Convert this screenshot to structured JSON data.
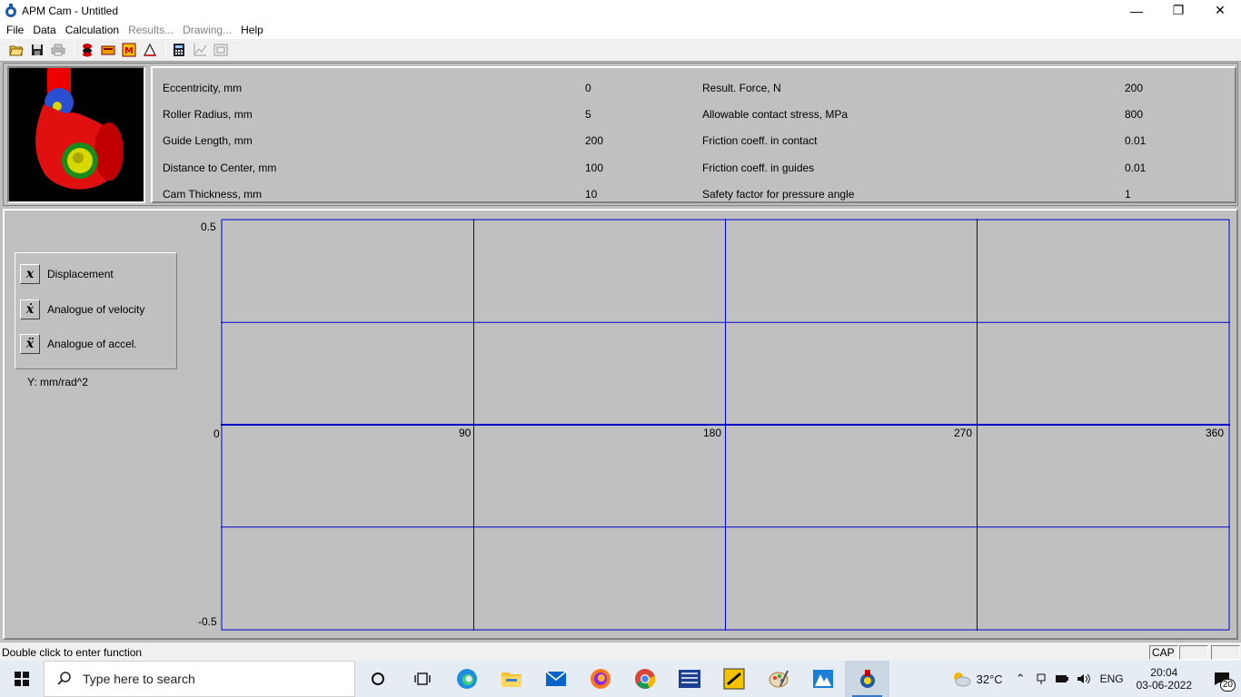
{
  "window": {
    "title": "APM Cam - Untitled",
    "minimize": "—",
    "maximize": "❐",
    "close": "✕"
  },
  "menu": [
    {
      "label": "File",
      "enabled": true
    },
    {
      "label": "Data",
      "enabled": true
    },
    {
      "label": "Calculation",
      "enabled": true
    },
    {
      "label": "Results...",
      "enabled": false
    },
    {
      "label": "Drawing...",
      "enabled": false
    },
    {
      "label": "Help",
      "enabled": true
    }
  ],
  "toolbar": [
    {
      "name": "open-icon"
    },
    {
      "name": "save-icon"
    },
    {
      "name": "print-icon"
    },
    {
      "name": "materials-icon"
    },
    {
      "name": "cam-icon"
    },
    {
      "name": "motion-icon"
    },
    {
      "name": "profile-icon"
    },
    {
      "name": "calculate-icon"
    },
    {
      "name": "chart-icon"
    },
    {
      "name": "drawing-icon"
    }
  ],
  "params_left": [
    {
      "label": "Eccentricity, mm",
      "value": "0"
    },
    {
      "label": "Roller Radius, mm",
      "value": "5"
    },
    {
      "label": "Guide Length, mm",
      "value": "200"
    },
    {
      "label": "Distance to Center, mm",
      "value": "100"
    },
    {
      "label": "Cam Thickness, mm",
      "value": "10"
    }
  ],
  "params_right": [
    {
      "label": "Result. Force, N",
      "value": "200"
    },
    {
      "label": "Allowable contact stress, MPa",
      "value": "800"
    },
    {
      "label": "Friction coeff. in contact",
      "value": "0.01"
    },
    {
      "label": "Friction coeff. in guides",
      "value": "0.01"
    },
    {
      "label": "Safety factor for pressure angle",
      "value": "1"
    }
  ],
  "legend": [
    {
      "symbol": "x",
      "label": "Displacement"
    },
    {
      "symbol": "ẋ",
      "label": "Analogue of velocity"
    },
    {
      "symbol": "ẍ",
      "label": "Analogue of accel."
    }
  ],
  "plot": {
    "y_unit": "Y: mm/rad^2",
    "y_ticks": [
      "0.5",
      "0",
      "-0.5"
    ],
    "x_ticks": [
      "90",
      "180",
      "270",
      "360"
    ],
    "grid_color": "#0000cc"
  },
  "chart_data": {
    "type": "line",
    "x": [],
    "series": [],
    "ylabel": "Y: mm/rad^2",
    "xlim": [
      0,
      360
    ],
    "ylim": [
      -0.5,
      0.5
    ],
    "x_ticks": [
      90,
      180,
      270,
      360
    ],
    "y_ticks": [
      0.5,
      0,
      -0.5
    ],
    "grid": true
  },
  "status": {
    "text": "Double click to enter function",
    "cap": "CAP"
  },
  "taskbar": {
    "search_placeholder": "Type here to search",
    "weather": "32°C",
    "lang": "ENG",
    "time": "20:04",
    "date": "03-06-2022",
    "notifications": "20"
  }
}
